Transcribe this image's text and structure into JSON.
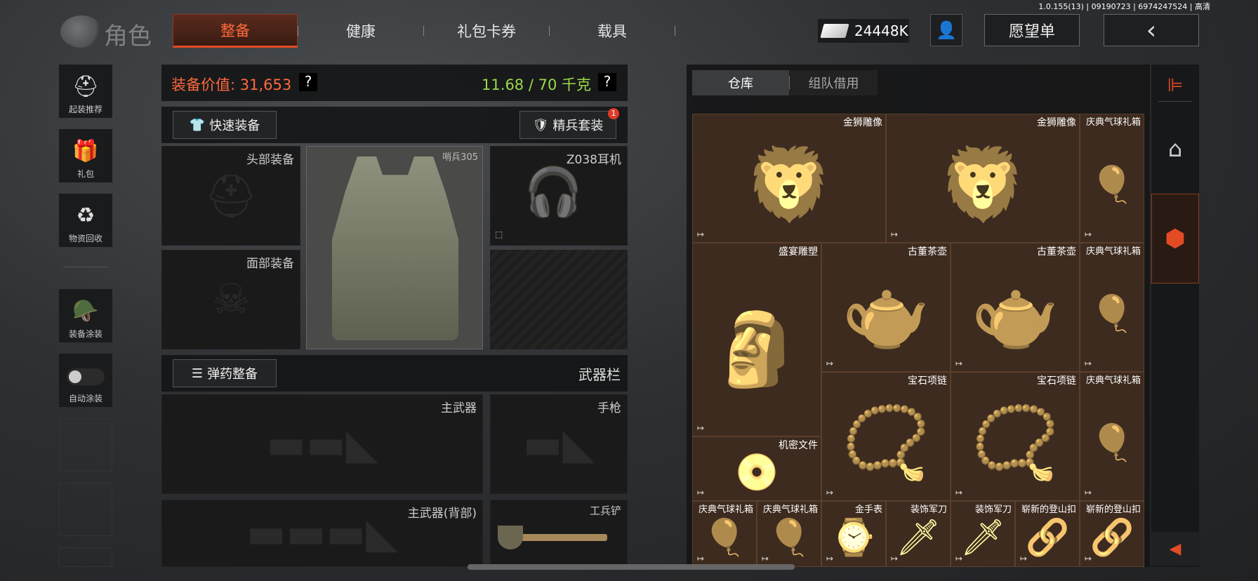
{
  "version": "1.0.155(13) | 09190723 | 6974247524 | 高清",
  "header": {
    "title": "角色",
    "tabs": [
      "整备",
      "健康",
      "礼包卡券",
      "载具"
    ],
    "currency": "24448K",
    "wishlist": "愿望单",
    "back": "‹"
  },
  "sidebar": [
    "起装推荐",
    "礼包",
    "物资回收",
    "装备涂装",
    "自动涂装"
  ],
  "equip": {
    "value_label": "装备价值: 31,653",
    "weight": "11.68 / 70 千克",
    "help": "?",
    "quick": "快速装备",
    "elite": "精兵套装",
    "elite_badge": "1",
    "head": "头部装备",
    "face": "面部装备",
    "armor_tag": "哨兵305",
    "headset": "Z038耳机",
    "ammo": "弹药整备",
    "weapon_bar": "武器栏",
    "primary": "主武器",
    "pistol": "手枪",
    "primary_back": "主武器(背部)",
    "shovel": "工兵铲"
  },
  "stash": {
    "tabs": [
      "仓库",
      "组队借用"
    ],
    "items": [
      {
        "name": "金狮雕像",
        "icon": "lion"
      },
      {
        "name": "金狮雕像",
        "icon": "lion"
      },
      {
        "name": "庆典气球礼箱",
        "icon": "balloon"
      },
      {
        "name": "盛宴雕塑",
        "icon": "bust"
      },
      {
        "name": "古董茶壶",
        "icon": "teapot"
      },
      {
        "name": "古董茶壶",
        "icon": "teapot"
      },
      {
        "name": "庆典气球礼箱",
        "icon": "balloon"
      },
      {
        "name": "宝石项链",
        "icon": "necklace"
      },
      {
        "name": "宝石项链",
        "icon": "necklace"
      },
      {
        "name": "庆典气球礼箱",
        "icon": "balloon"
      },
      {
        "name": "机密文件",
        "icon": "disk"
      },
      {
        "name": "庆典气球礼箱",
        "icon": "balloon"
      },
      {
        "name": "庆典气球礼箱",
        "icon": "balloon"
      },
      {
        "name": "金手表",
        "icon": "watch"
      },
      {
        "name": "装饰军刀",
        "icon": "knife"
      },
      {
        "name": "装饰军刀",
        "icon": "knife"
      },
      {
        "name": "崭新的登山扣",
        "icon": "carabiner"
      },
      {
        "name": "崭新的登山扣",
        "icon": "carabiner"
      }
    ]
  },
  "colors": {
    "accent": "#ff6a3c",
    "weight": "#9bd94a",
    "cell_bg": "#3e2b1f"
  }
}
